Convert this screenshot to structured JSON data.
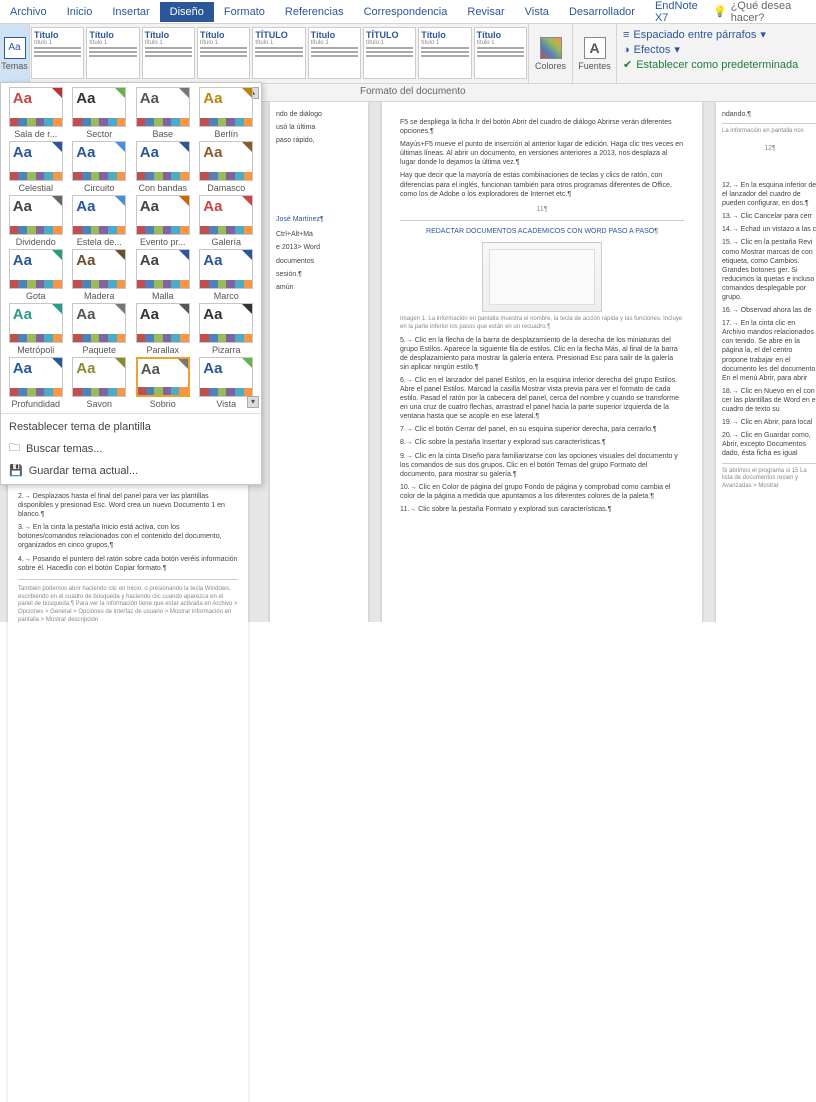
{
  "tabs": [
    "Archivo",
    "Inicio",
    "Insertar",
    "Diseño",
    "Formato",
    "Referencias",
    "Correspondencia",
    "Revisar",
    "Vista",
    "Desarrollador",
    "EndNote X7"
  ],
  "activeTab": 3,
  "tellMe": "¿Qué desea hacer?",
  "temasLabel": "Temas",
  "styleTitles": [
    "Título",
    "Título",
    "Título",
    "Título",
    "TÍTULO",
    "Título",
    "TÍTULO",
    "Título",
    "Título"
  ],
  "coloresLabel": "Colores",
  "fuentesLabel": "Fuentes",
  "rightOptions": {
    "spacing": "Espaciado entre párrafos",
    "effects": "Efectos",
    "default": "Establecer como predeterminada"
  },
  "formatoDoc": "Formato del documento",
  "themes": [
    {
      "name": "Sala de r...",
      "aa": "#c44",
      "corner": "#b33"
    },
    {
      "name": "Sector",
      "aa": "#333",
      "corner": "#6ab04c"
    },
    {
      "name": "Base",
      "aa": "#555",
      "corner": "#777"
    },
    {
      "name": "Berlín",
      "aa": "#b8860b",
      "corner": "#b8860b"
    },
    {
      "name": "Celestial",
      "aa": "#2b579a",
      "corner": "#2b579a"
    },
    {
      "name": "Circuito",
      "aa": "#2b579a",
      "corner": "#4a90d9"
    },
    {
      "name": "Con bandas",
      "aa": "#2b5797",
      "corner": "#2b5797"
    },
    {
      "name": "Damasco",
      "aa": "#8a5a2b",
      "corner": "#8a5a2b"
    },
    {
      "name": "Dividendo",
      "aa": "#444",
      "corner": "#666"
    },
    {
      "name": "Estela de...",
      "aa": "#2b579a",
      "corner": "#4a90d9"
    },
    {
      "name": "Evento pr...",
      "aa": "#444",
      "corner": "#c60"
    },
    {
      "name": "Galería",
      "aa": "#c44",
      "corner": "#c44"
    },
    {
      "name": "Gota",
      "aa": "#2b579a",
      "corner": "#2b9a7a"
    },
    {
      "name": "Madera",
      "aa": "#6b4f2a",
      "corner": "#6b4f2a"
    },
    {
      "name": "Malla",
      "aa": "#444",
      "corner": "#2b579a"
    },
    {
      "name": "Marco",
      "aa": "#2b579a",
      "corner": "#2b579a"
    },
    {
      "name": "Metrópoli",
      "aa": "#2b9a8a",
      "corner": "#2b9a8a"
    },
    {
      "name": "Paquete",
      "aa": "#555",
      "corner": "#777"
    },
    {
      "name": "Parallax",
      "aa": "#333",
      "corner": "#555"
    },
    {
      "name": "Pizarra",
      "aa": "#333",
      "corner": "#333"
    },
    {
      "name": "Profundidad",
      "aa": "#2b579a",
      "corner": "#2b579a"
    },
    {
      "name": "Savon",
      "aa": "#8a8a2b",
      "corner": "#8a8a2b"
    },
    {
      "name": "Sobrio",
      "aa": "#555",
      "corner": "#777",
      "sel": true
    },
    {
      "name": "Vista",
      "aa": "#2b579a",
      "corner": "#6ab04c"
    }
  ],
  "ddFooter": {
    "reset": "Restablecer tema de plantilla",
    "browse": "Buscar temas...",
    "save": "Guardar tema actual..."
  },
  "palette": [
    "#c0504d",
    "#4f81bd",
    "#9bbb59",
    "#8064a2",
    "#4bacc6",
    "#f79646"
  ],
  "docTitle": "REDACTAR DOCUMENTOS ACADEMICOS CON WORD PASO A PASO¶",
  "author": "José Martínez¶",
  "centerTop": [
    "F5 se despliega la ficha Ir del botón Abrir del cuadro de diálogo Abrirse verán diferentes opciones.¶",
    "Mayús+F5 mueve el punto de inserción al anterior lugar de edición. Haga clic tres veces en últimas líneas. Al abrir un documento, en versiones anteriores a 2013, nos desplaza al lugar donde lo dejamos la última vez.¶",
    "Hay que decir que la mayoría de estas combinaciones de teclas y clics de ratón, con diferencias para el inglés, funcionan también para otros programas diferentes de Office, como los de Adobe o los exploradores de Internet etc.¶"
  ],
  "centerList": [
    "5.→ Clic en la flecha de la barra de desplazamiento de la derecha de los miniaturas del grupo Estilos. Aparece la siguiente fila de estilos. Clic en la flecha Más, al final de la barra de desplazamiento para mostrar la galería entera. Presionad Esc para salir de la galería sin aplicar ningún estilo.¶",
    "6.→ Clic en el lanzador del panel Estilos, en la esquina inferior derecha del grupo Estilos. Abre el panel Estilos. Marcad la casilla Mostrar vista previa para ver el formato de cada estilo. Pasad el ratón por la cabecera del panel, cerca del nombre y cuando se transforme en una cruz de cuatro flechas, arrastrad el panel hacia la parte superior izquierda de la ventana hasta que se acople en ese lateral.¶",
    "7.→ Clic el botón Cerrar del panel, en su esquina superior derecha, para cerrarlo.¶",
    "8.→ Clic sobre la pestaña Insertar y explorad sus características.¶",
    "9.→ Clic en la cinta Diseño para familiarizarse con las opciones visuales del documento y los comandos de sus dos grupos. Clic en el botón Temas del grupo Formato del documento, para mostrar su galería.¶",
    "10.→ Clic en Color de página del grupo Fondo de página y comprobad como cambia el color de la página a medida que apuntamos a los diferentes colores de la paleta.¶",
    "11.→ Clic sobre la pestaña Formato y explorad sus características.¶"
  ],
  "rightPageNum": "12¶",
  "centerPageNum": "11¶",
  "rightList": [
    "12.→ En la esquina inferior de el lanzador del cuadro de pueden configurar, en dos.¶",
    "13.→ Clic Cancelar para cerr",
    "14.→ Echad un vistazo a las c",
    "15.→ Clic en la pestaña Revi como Mostrar marcas de con etiqueta, como Cambios. Grandes botones ger. Si reducimos la quetas e incluso comandos desplegable por grupo.",
    "16.→ Observad ahora las de",
    "17.→ En la cinta clic en Archivo mandos relacionados con tenido. Se abre en la página la, el del centro propone trabajar en el documento les del documento. En el menú Abrir, para abrir",
    "18.→ Clic en Nuevo en el con cer las plantillas de Word en el cuadro de texto su",
    "19.→ Clic en Abrir, para local",
    "20.→ Clic en Guardar como, Abrir, excepto Documentos dado, ésta ficha es igual"
  ],
  "rightFoot": "Si abrimos el programa si 15 La lista de documentos recien y Avanzadas > Mostrar",
  "leftStrip": [
    "ndo de diálogo",
    "usó la última",
    "paso rápido,"
  ],
  "leftPage2": [
    "Ctrl+Alt+Ma",
    "e 2013> Word",
    "documentos",
    "sesión.¶",
    "amún"
  ],
  "bottomLeft": [
    "2.→ Desplazaos hasta el final del panel para ver las plantillas disponibles y presionad Esc. Word crea un nuevo Documento 1 en blanco.¶",
    "3.→ En la cinta la pestaña Inicio está activa, con los botones/comandos relacionados con el contenido del documento, organizados en cinco grupos.¶",
    "4.→ Posando el puntero del ratón sobre cada botón veréis información sobre él. Hacedlo con el botón Copiar formato.¶"
  ],
  "bottomFoot": "También podemos abrir haciendo clic en Inicio, o presionando la tecla Windows, escribiendo en el cuadro de búsqueda y haciendo clic cuando aparezca en el panel de búsqueda.¶ Para ver la información tiene que estar activada en Archivo > Opciones > General > Opciones de interfaz de usuario > Mostrar información en pantalla > Mostrar descripción",
  "rightTopText": "ndando.¶",
  "rightTopFoot": "La información en pantalla nos"
}
